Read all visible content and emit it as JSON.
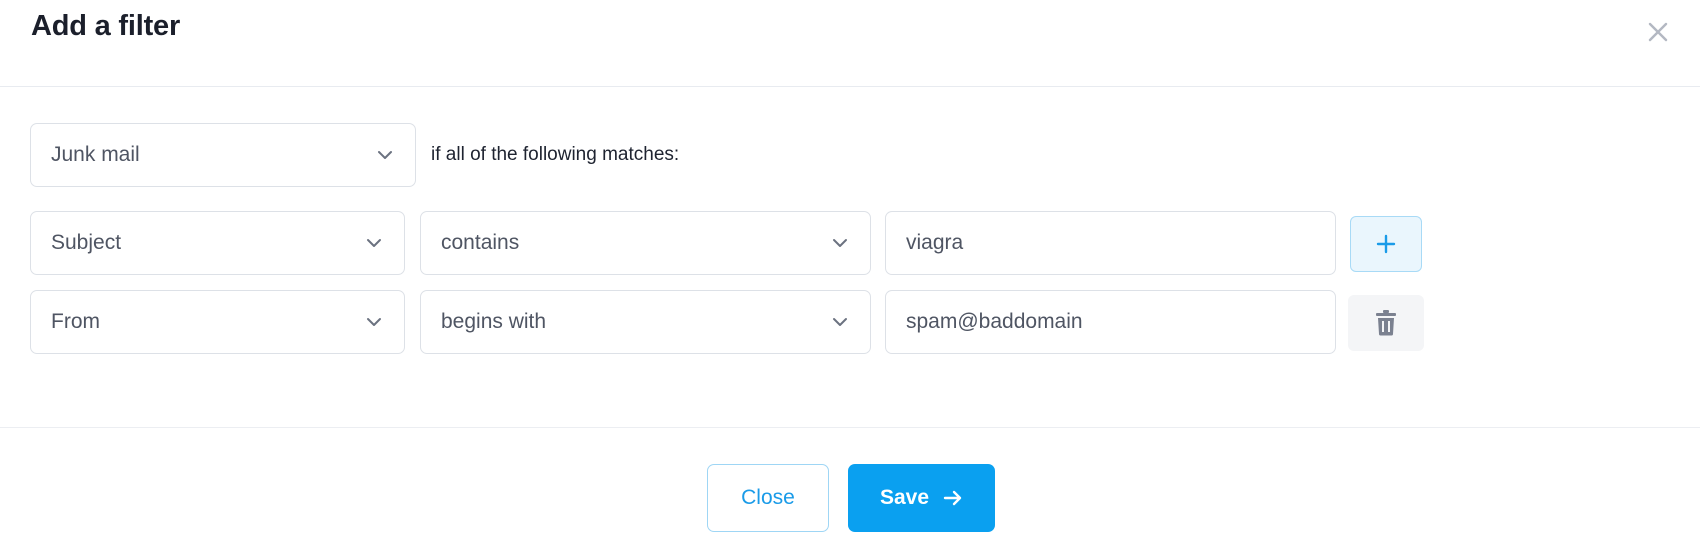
{
  "dialog": {
    "title": "Add a filter",
    "close_icon": "close-icon"
  },
  "action": {
    "selected": "Junk mail",
    "suffix_text": "if all of the following matches:"
  },
  "rules": [
    {
      "field": "Subject",
      "operator": "contains",
      "value": "viagra",
      "row_action": "plus-icon"
    },
    {
      "field": "From",
      "operator": "begins with",
      "value": "spam@baddomain",
      "row_action": "trash-icon"
    }
  ],
  "footer": {
    "close_label": "Close",
    "save_label": "Save",
    "save_icon": "arrow-right-icon"
  },
  "colors": {
    "accent": "#0aa0f0",
    "accent_light": "#eaf6fd",
    "border": "#dde1e7"
  }
}
